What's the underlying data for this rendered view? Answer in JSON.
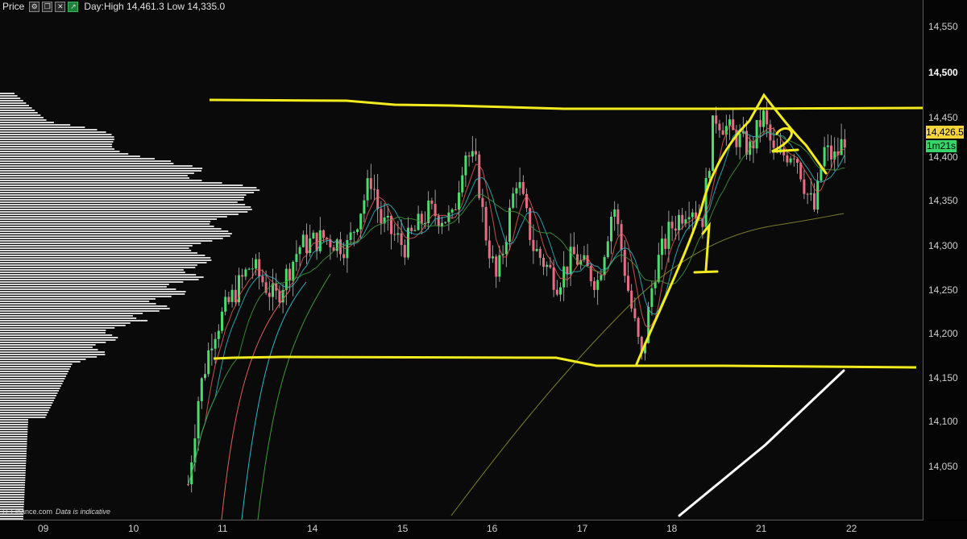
{
  "header": {
    "title": "Price",
    "info": "Day:High 14,461.3 Low 14,335.0"
  },
  "price_axis": {
    "ticks": [
      "14,550",
      "14,500",
      "14,450",
      "14,400",
      "14,350",
      "14,300",
      "14,250",
      "14,200",
      "14,150",
      "14,100",
      "14,050"
    ],
    "emphasized": "14,500",
    "current_price": "14,426.5",
    "countdown": "1m21s"
  },
  "time_axis": {
    "ticks": [
      "09",
      "10",
      "11",
      "14",
      "15",
      "16",
      "17",
      "18",
      "21",
      "22"
    ]
  },
  "watermark": {
    "source": "IT-Finance.com",
    "note": "Data is indicative"
  },
  "colors": {
    "background": "#0a0a0a",
    "bull_candle": "#4bdc6e",
    "bear_candle": "#e46f84",
    "annotation": "#f2ec1e",
    "trend_line": "#ffffff",
    "volume_profile": "#e8e8e8",
    "price_badge": "#f5d53a",
    "timer_badge": "#37d46a"
  },
  "chart_data": {
    "type": "candlestick",
    "instrument_range": {
      "day_high": 14461.3,
      "day_low": 14335.0
    },
    "ylim": [
      14000,
      14575
    ],
    "x_categories": [
      "09",
      "10",
      "11",
      "14",
      "15",
      "16",
      "17",
      "18",
      "21",
      "22"
    ],
    "overlays": [
      "volume-profile",
      "moving-average-fast",
      "moving-average-medium",
      "moving-average-slow",
      "moving-average-long"
    ],
    "annotations": [
      {
        "type": "horizontal-line",
        "level": 14455,
        "color": "#f2ec1e"
      },
      {
        "type": "horizontal-line",
        "level": 14165,
        "color": "#f2ec1e"
      },
      {
        "type": "trend-line",
        "color": "#ffffff"
      },
      {
        "type": "hand-drawn-label",
        "text": "1"
      },
      {
        "type": "hand-drawn-label",
        "text": "2"
      }
    ]
  }
}
